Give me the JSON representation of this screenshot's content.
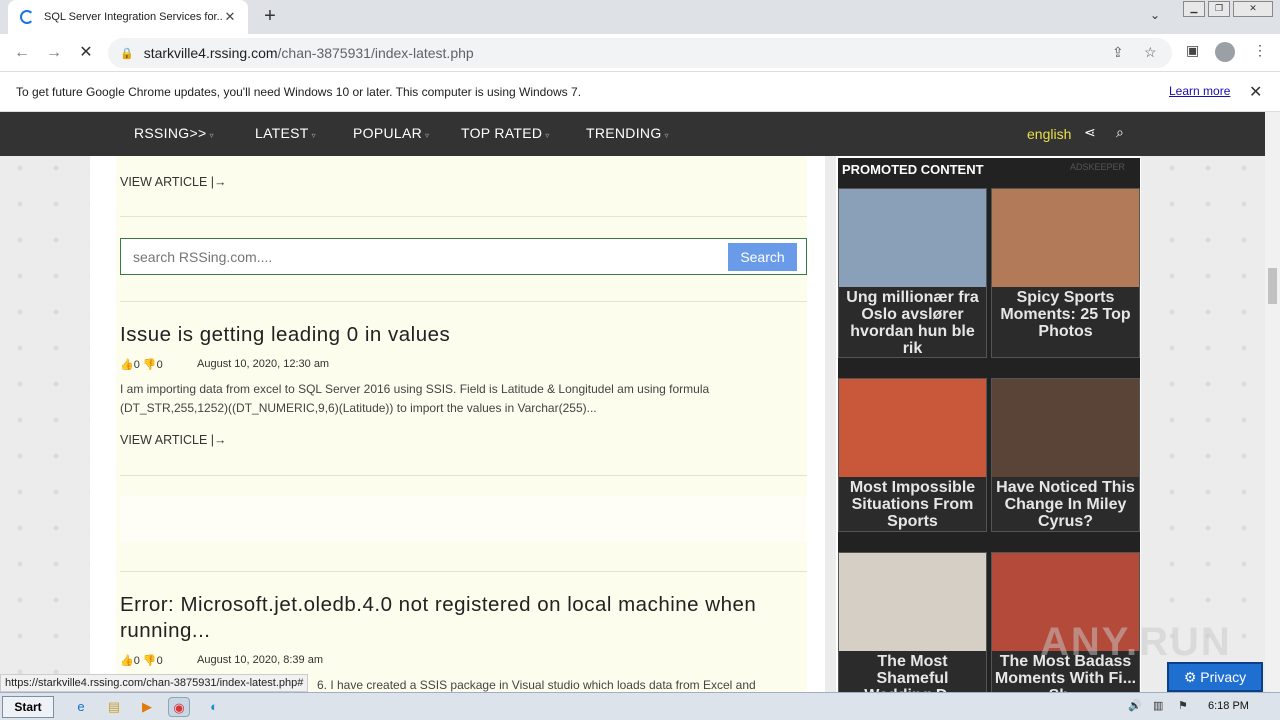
{
  "browser": {
    "tab_title": "SQL Server Integration Services for...",
    "tab_close": "✕",
    "new_tab": "+",
    "url_domain": "starkville4.rssing.com",
    "url_path": "/chan-3875931/index-latest.php"
  },
  "infobar": {
    "message": "To get future Google Chrome updates, you'll need Windows 10 or later. This computer is using Windows 7.",
    "learn_more": "Learn more",
    "close": "✕"
  },
  "nav": {
    "items": [
      "RSSING>>",
      "LATEST",
      "POPULAR",
      "TOP RATED",
      "TRENDING"
    ],
    "caret": "▿",
    "language": "english"
  },
  "content": {
    "view_article_1": "VIEW ARTICLE |→",
    "search_placeholder": "search RSSing.com....",
    "search_button": "Search",
    "articles": [
      {
        "title": "Issue is getting leading 0 in values",
        "likes": "0",
        "dislikes": "0",
        "date": "August 10, 2020, 12:30 am",
        "excerpt": "I am importing data from excel to SQL Server 2016 using SSIS. Field is Latitude & Longitudel am using formula (DT_STR,255,1252)((DT_NUMERIC,9,6)(Latitude)) to import the values in Varchar(255)...",
        "view": "VIEW ARTICLE |→"
      },
      {
        "title": "Error: Microsoft.jet.oledb.4.0 not registered on local machine when running...",
        "likes": "0",
        "dislikes": "0",
        "date": "August 10, 2020, 8:39 am",
        "excerpt": "6. I have created a SSIS package in Visual studio which loads data from Excel and"
      }
    ]
  },
  "sidebar": {
    "header": "PROMOTED CONTENT",
    "brand": "ADSKEEPER",
    "cards": [
      {
        "caption": "Ung millionær fra Oslo avslører hvordan hun ble rik",
        "color": "#8aa0b8"
      },
      {
        "caption": "Spicy Sports Moments: 25 Top Photos",
        "color": "#b37a5a"
      },
      {
        "caption": "Most Impossible Situations From Sports",
        "color": "#c9583a"
      },
      {
        "caption": "Have Noticed This Change In Miley Cyrus?",
        "color": "#5a4438"
      },
      {
        "caption": "The Most Shameful Wedding D...",
        "color": "#d6cfc6"
      },
      {
        "caption": "The Most Badass Moments With Fi... Sh...",
        "color": "#b44a3a"
      }
    ]
  },
  "overlay": {
    "watermark": "ANY.RUN",
    "privacy": "⚙ Privacy"
  },
  "statusbar": {
    "url": "https://starkville4.rssing.com/chan-3875931/index-latest.php#"
  },
  "taskbar": {
    "start": "Start",
    "time": "6:18 PM"
  }
}
